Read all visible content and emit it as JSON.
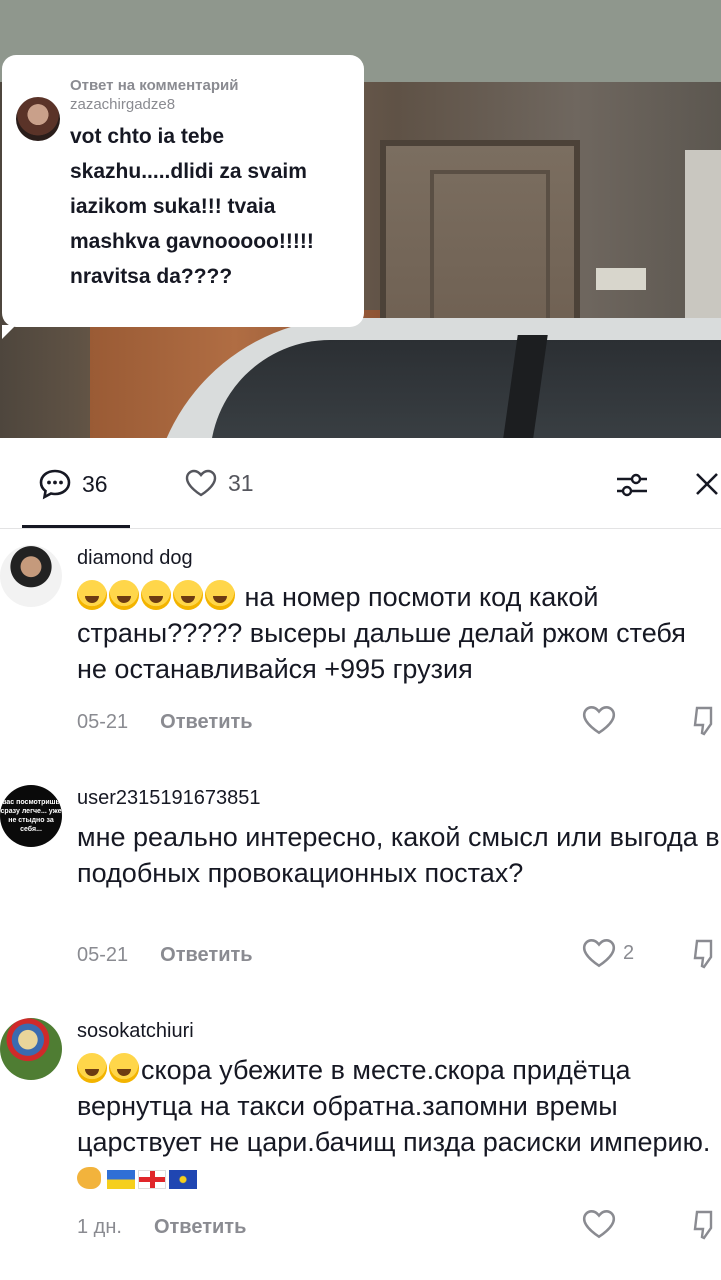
{
  "reply_bubble": {
    "label": "Ответ на комментарий",
    "username": "zazachirgadze8",
    "text": "vot chto ia tebe skazhu.....dlidi za svaim iazikom suka!!! tvaia mashkva gavnooooo!!!!! nravitsa da????"
  },
  "stats": {
    "comments_count": "36",
    "likes_count": "31"
  },
  "comments": [
    {
      "username": "diamond dog",
      "emoji_count": 5,
      "text": "на номер посмоти код какой страны????? высеры дальше делай ржом стебя не останавливайся +995 грузия",
      "date": "05-21",
      "reply_label": "Ответить",
      "likes": ""
    },
    {
      "username": "user2315191673851",
      "avatar_text": "вас посмотришь сразу легче... уже не стыдно за себя...",
      "text": "мне реально интересно, какой смысл или выгода в подобных провокационных постах?",
      "date": "05-21",
      "reply_label": "Ответить",
      "likes": "2"
    },
    {
      "username": "sosokatchiuri",
      "emoji_count": 2,
      "text": "скора убежите в месте.скора придётца вернутца на такси обратна.запомни времы царствует не цари.бачищ пизда расиски империю.",
      "flags": [
        "ukraine-flag",
        "georgia-flag",
        "eu-flag"
      ],
      "date": "1 дн.",
      "reply_label": "Ответить",
      "likes": ""
    }
  ],
  "colors": {
    "text_primary": "#161823",
    "text_secondary": "#8a8b91",
    "divider": "#e3e3e4"
  }
}
